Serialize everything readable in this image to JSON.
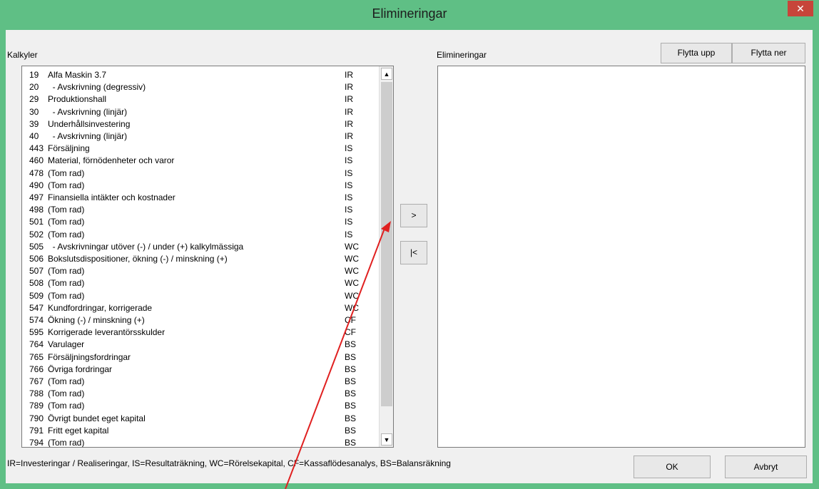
{
  "window": {
    "title": "Elimineringar",
    "close_glyph": "✕"
  },
  "left_panel": {
    "label": "Kalkyler",
    "rows": [
      {
        "num": "19",
        "name": "Alfa Maskin 3.7",
        "code": "IR"
      },
      {
        "num": "20",
        "name": "  - Avskrivning (degressiv)",
        "code": "IR"
      },
      {
        "num": "29",
        "name": "Produktionshall",
        "code": "IR"
      },
      {
        "num": "30",
        "name": "  - Avskrivning (linjär)",
        "code": "IR"
      },
      {
        "num": "39",
        "name": "Underhållsinvestering",
        "code": "IR"
      },
      {
        "num": "40",
        "name": "  - Avskrivning (linjär)",
        "code": "IR"
      },
      {
        "num": "443",
        "name": "Försäljning",
        "code": "IS"
      },
      {
        "num": "460",
        "name": "Material, förnödenheter och varor",
        "code": "IS"
      },
      {
        "num": "478",
        "name": "(Tom rad)",
        "code": "IS"
      },
      {
        "num": "490",
        "name": "(Tom rad)",
        "code": "IS"
      },
      {
        "num": "497",
        "name": "Finansiella intäkter och kostnader",
        "code": "IS"
      },
      {
        "num": "498",
        "name": "(Tom rad)",
        "code": "IS"
      },
      {
        "num": "501",
        "name": "(Tom rad)",
        "code": "IS"
      },
      {
        "num": "502",
        "name": "(Tom rad)",
        "code": "IS"
      },
      {
        "num": "505",
        "name": "  - Avskrivningar utöver (-) / under (+) kalkylmässiga",
        "code": "WC"
      },
      {
        "num": "506",
        "name": "Bokslutsdispositioner, ökning (-) / minskning (+)",
        "code": "WC"
      },
      {
        "num": "507",
        "name": "(Tom rad)",
        "code": "WC"
      },
      {
        "num": "508",
        "name": "(Tom rad)",
        "code": "WC"
      },
      {
        "num": "509",
        "name": "(Tom rad)",
        "code": "WC"
      },
      {
        "num": "547",
        "name": "Kundfordringar, korrigerade",
        "code": "WC"
      },
      {
        "num": "574",
        "name": "Ökning (-) / minskning (+)",
        "code": "CF"
      },
      {
        "num": "595",
        "name": "Korrigerade leverantörsskulder",
        "code": "CF"
      },
      {
        "num": "764",
        "name": "Varulager",
        "code": "BS"
      },
      {
        "num": "765",
        "name": "Försäljningsfordringar",
        "code": "BS"
      },
      {
        "num": "766",
        "name": "Övriga fordringar",
        "code": "BS"
      },
      {
        "num": "767",
        "name": "(Tom rad)",
        "code": "BS"
      },
      {
        "num": "788",
        "name": "(Tom rad)",
        "code": "BS"
      },
      {
        "num": "789",
        "name": "(Tom rad)",
        "code": "BS"
      },
      {
        "num": "790",
        "name": "Övrigt bundet eget kapital",
        "code": "BS"
      },
      {
        "num": "791",
        "name": "Fritt eget kapital",
        "code": "BS"
      },
      {
        "num": "794",
        "name": "(Tom rad)",
        "code": "BS"
      }
    ],
    "scroll_up_glyph": "▲",
    "scroll_down_glyph": "▼"
  },
  "middle": {
    "add_label": ">",
    "remove_label": "|<"
  },
  "right_panel": {
    "label": "Elimineringar",
    "move_up_label": "Flytta upp",
    "move_down_label": "Flytta ner"
  },
  "footer": {
    "legend": "IR=Investeringar / Realiseringar, IS=Resultaträkning, WC=Rörelsekapital, CF=Kassaflödesanalys, BS=Balansräkning",
    "ok_label": "OK",
    "cancel_label": "Avbryt"
  },
  "colors": {
    "frame": "#5fbf85",
    "close": "#c7453a",
    "annotation_arrow": "#e02020"
  }
}
